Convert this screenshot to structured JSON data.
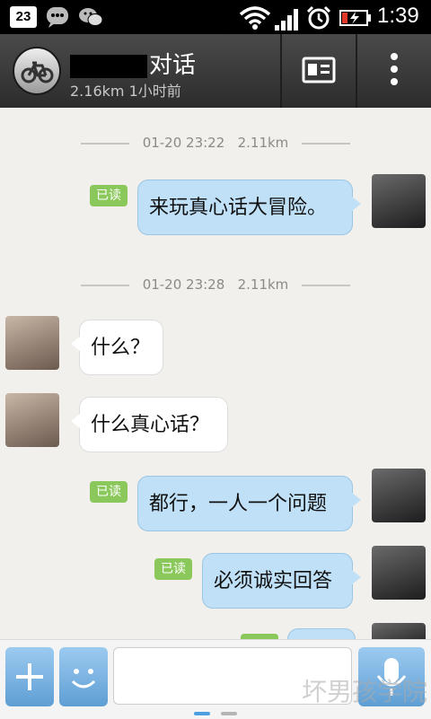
{
  "status_bar": {
    "calendar_day": "23",
    "time": "1:39",
    "icons": [
      "calendar-icon",
      "message-icon",
      "wechat-icon",
      "wifi-icon",
      "signal-icon",
      "alarm-icon",
      "battery-icon"
    ]
  },
  "header": {
    "title": "对话",
    "subtitle": "2.16km 1小时前",
    "avatar_icon": "bicycle-icon",
    "card_icon": "profile-card-icon",
    "more_icon": "more-vertical-icon"
  },
  "conversation": {
    "dividers": [
      {
        "date": "01-20 23:22",
        "distance": "2.11km"
      },
      {
        "date": "01-20 23:28",
        "distance": "2.11km"
      }
    ],
    "messages": [
      {
        "direction": "out",
        "text": "来玩真心话大冒险。",
        "status": "已读"
      },
      {
        "direction": "in",
        "text": "什么？"
      },
      {
        "direction": "in",
        "text": "什么真心话？"
      },
      {
        "direction": "out",
        "text": "都行，一人一个问题",
        "status": "已读"
      },
      {
        "direction": "out",
        "text": "必须诚实回答",
        "status": "已读"
      }
    ]
  },
  "input_bar": {
    "plus_icon": "plus-icon",
    "emoji_icon": "emoji-icon",
    "mic_icon": "microphone-icon",
    "input_value": "",
    "watermark": "坏男孩学院"
  },
  "colors": {
    "header_bg": "#3a3a3a",
    "chat_bg": "#f1f0ec",
    "outgoing_bubble": "#bfe0f7",
    "incoming_bubble": "#ffffff",
    "read_badge": "#8bc85c",
    "input_button": "#6fa9dc"
  }
}
